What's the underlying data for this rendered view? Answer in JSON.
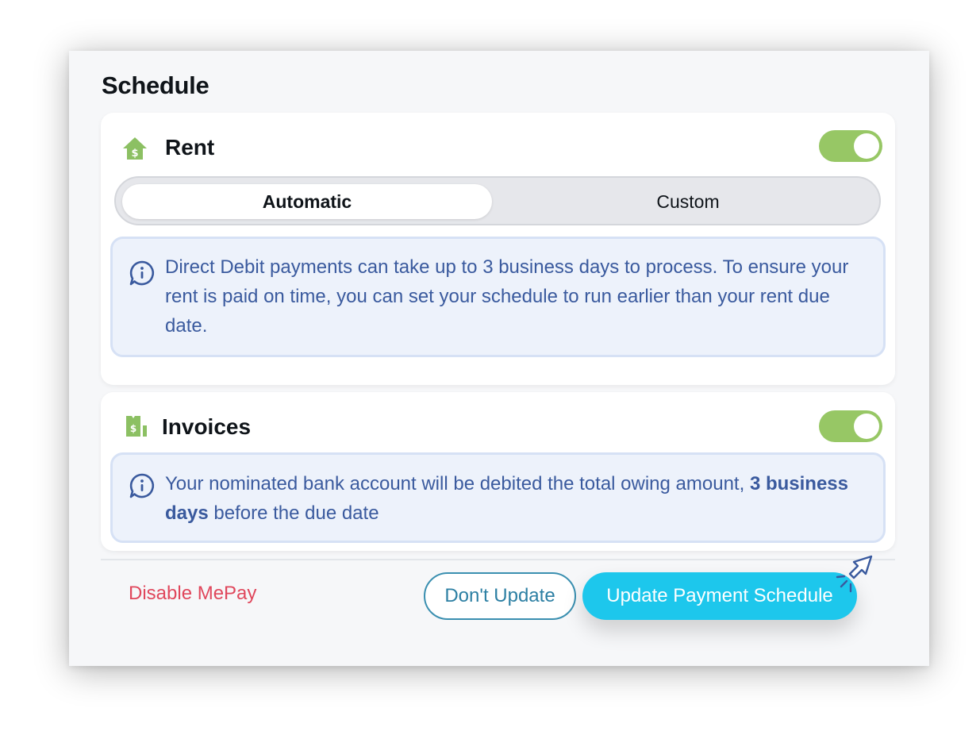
{
  "schedule": {
    "title": "Schedule"
  },
  "rent": {
    "title": "Rent",
    "toggle_on": true,
    "modes": {
      "automatic": "Automatic",
      "custom": "Custom",
      "selected": "Automatic"
    },
    "info": "Direct Debit payments can take up to 3 business days to process. To ensure your rent is paid on time, you can set your schedule to run earlier than your rent due date."
  },
  "invoices": {
    "title": "Invoices",
    "toggle_on": true,
    "info_before": "Your nominated bank account will be debited the total owing amount, ",
    "info_bold": "3 business days",
    "info_after": " before the due date"
  },
  "footer": {
    "disable_label": "Disable MePay",
    "dont_update_label": "Don't Update",
    "update_label": "Update Payment Schedule"
  },
  "colors": {
    "toggle_on": "#97c765",
    "primary": "#1dc7ec",
    "danger": "#e0475c",
    "info_text": "#3a5a9e",
    "info_bg": "#edf2fb",
    "icon_green": "#8cc063"
  },
  "icons": {
    "rent": "house-dollar-icon",
    "invoices": "receipt-dollar-icon",
    "info": "info-icon",
    "cursor": "click-cursor-icon"
  }
}
